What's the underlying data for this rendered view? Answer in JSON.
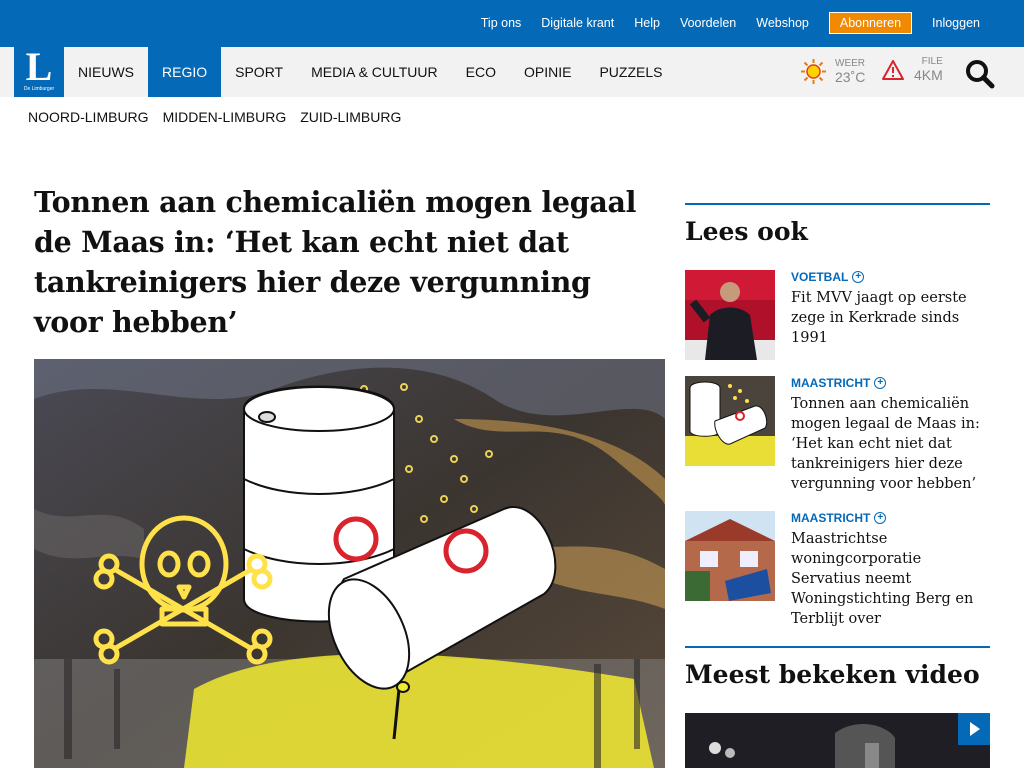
{
  "top_links": [
    "Tip ons",
    "Digitale krant",
    "Help",
    "Voordelen",
    "Webshop",
    "Abonneren",
    "Inloggen"
  ],
  "logo": {
    "letter": "L",
    "tagline": "De Limburger"
  },
  "nav": [
    "NIEUWS",
    "REGIO",
    "SPORT",
    "MEDIA & CULTUUR",
    "ECO",
    "OPINIE",
    "PUZZELS"
  ],
  "nav_active": "REGIO",
  "weather": {
    "label": "WEER",
    "value": "23˚C",
    "icon": "sun-icon"
  },
  "traffic": {
    "label": "FILE",
    "value": "4KM",
    "icon": "warning-icon"
  },
  "search_icon": "search-icon",
  "subnav": [
    "NOORD-LIMBURG",
    "MIDDEN-LIMBURG",
    "ZUID-LIMBURG"
  ],
  "article": {
    "headline": "Tonnen aan chemicaliën mogen legaal de Maas in: ‘Het kan echt niet dat tankreinigers hier deze vergunning voor hebben’"
  },
  "sidebar": {
    "read_more_title": "Lees ook",
    "items": [
      {
        "category": "VOETBAL",
        "title": "Fit MVV jaagt op eerste zege in Kerkrade sinds 1991"
      },
      {
        "category": "MAASTRICHT",
        "title": "Tonnen aan chemicaliën mogen legaal de Maas in: ‘Het kan echt niet dat tankreinigers hier deze vergunning voor hebben’"
      },
      {
        "category": "MAASTRICHT",
        "title": "Maastrichtse woningcorporatie Servatius neemt Woningstichting Berg en Terblijt over"
      }
    ],
    "video_title": "Meest bekeken video"
  },
  "colors": {
    "brand": "#0469b7",
    "accent": "#f18a00"
  }
}
